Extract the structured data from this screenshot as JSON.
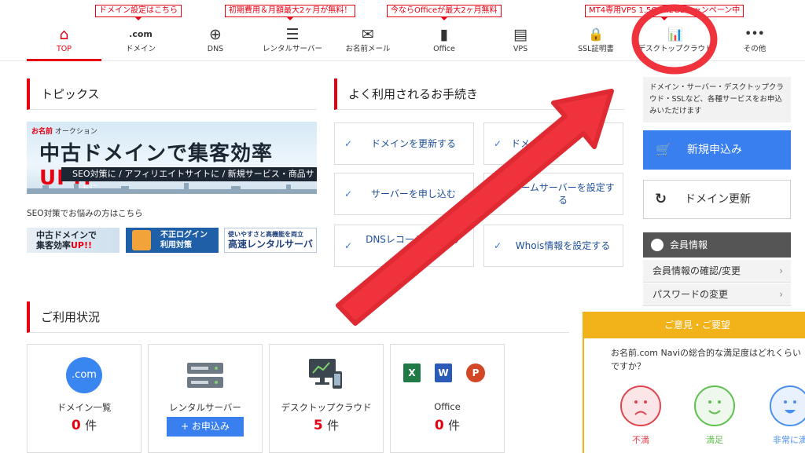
{
  "promos": [
    "ドメイン設定はこちら",
    "初期費用＆月額最大2ヶ月が無料！",
    "今ならOfficeが最大2ヶ月無料",
    "MT4専用VPS 1.5GB&2GBキャンペーン中"
  ],
  "nav": [
    {
      "label": "TOP",
      "icon": "home-icon",
      "glyph": "⌂"
    },
    {
      "label": "ドメイン",
      "icon": "dotcom-icon",
      "glyph": ".com"
    },
    {
      "label": "DNS",
      "icon": "globe-icon",
      "glyph": "⊕"
    },
    {
      "label": "レンタルサーバー",
      "icon": "server-icon",
      "glyph": "☰"
    },
    {
      "label": "お名前メール",
      "icon": "mail-icon",
      "glyph": "✉"
    },
    {
      "label": "Office",
      "icon": "office-icon",
      "glyph": "▮"
    },
    {
      "label": "VPS",
      "icon": "vps-icon",
      "glyph": "▤"
    },
    {
      "label": "SSL証明書",
      "icon": "lock-icon",
      "glyph": "🔒"
    },
    {
      "label": "デスクトップクラウド",
      "icon": "chart-icon",
      "glyph": "📊"
    },
    {
      "label": "その他",
      "icon": "more-icon",
      "glyph": "•••"
    }
  ],
  "topics": {
    "heading": "トピックス",
    "hero_brand_prefix": "お名前",
    "hero_brand": "オークション",
    "hero_title": "中古ドメインで集客効率",
    "hero_title_em": "UP!!",
    "hero_strip": "SEO対策に / アフィリエイトサイトに / 新規サービス・商品サイトに",
    "seo_text": "SEO対策でお悩みの方はこちら",
    "banner1_line1": "中古ドメインで",
    "banner1_line2": "集客効率",
    "banner1_em": "UP!!",
    "banner2_line1": "不正ログイン",
    "banner2_line2": "利用対策",
    "banner3_line1": "使いやすさと高機能を両立",
    "banner3_line2": "高速レンタルサーバー"
  },
  "procedures": {
    "heading": "よく利用されるお手続き",
    "items": [
      "ドメインを更新する",
      "ドメ",
      "サーバーを申し込む",
      "ネームサーバーを設定する",
      "DNSレコードを設定する",
      "Whois情報を設定する"
    ]
  },
  "sidebar": {
    "info": "ドメイン・サーバー・デスクトップクラウド・SSLなど、各種サービスをお申込みいただけます",
    "new_label": "新規申込み",
    "renew_label": "ドメイン更新",
    "member_heading": "会員情報",
    "member_links": [
      "会員情報の確認/変更",
      "パスワードの変更"
    ]
  },
  "usage": {
    "heading": "ご利用状況",
    "unit": "件",
    "cards": [
      {
        "name": "ドメイン一覧",
        "count": "0",
        "icon_text": ".com"
      },
      {
        "name": "レンタルサーバー",
        "button": "+ お申込み"
      },
      {
        "name": "デスクトップクラウド",
        "count": "5"
      },
      {
        "name": "Office",
        "count": "0"
      }
    ]
  },
  "survey": {
    "heading": "ご意見・ご要望",
    "question": "お名前.com Naviの総合的な満足度はどれくらいですか？",
    "options": [
      "不満",
      "満足",
      "非常に満"
    ]
  },
  "colors": {
    "brand_red": "#e60012",
    "accent_blue": "#3a7ff0",
    "survey_yellow": "#f2b31a",
    "annotation_red": "#f0323c"
  }
}
